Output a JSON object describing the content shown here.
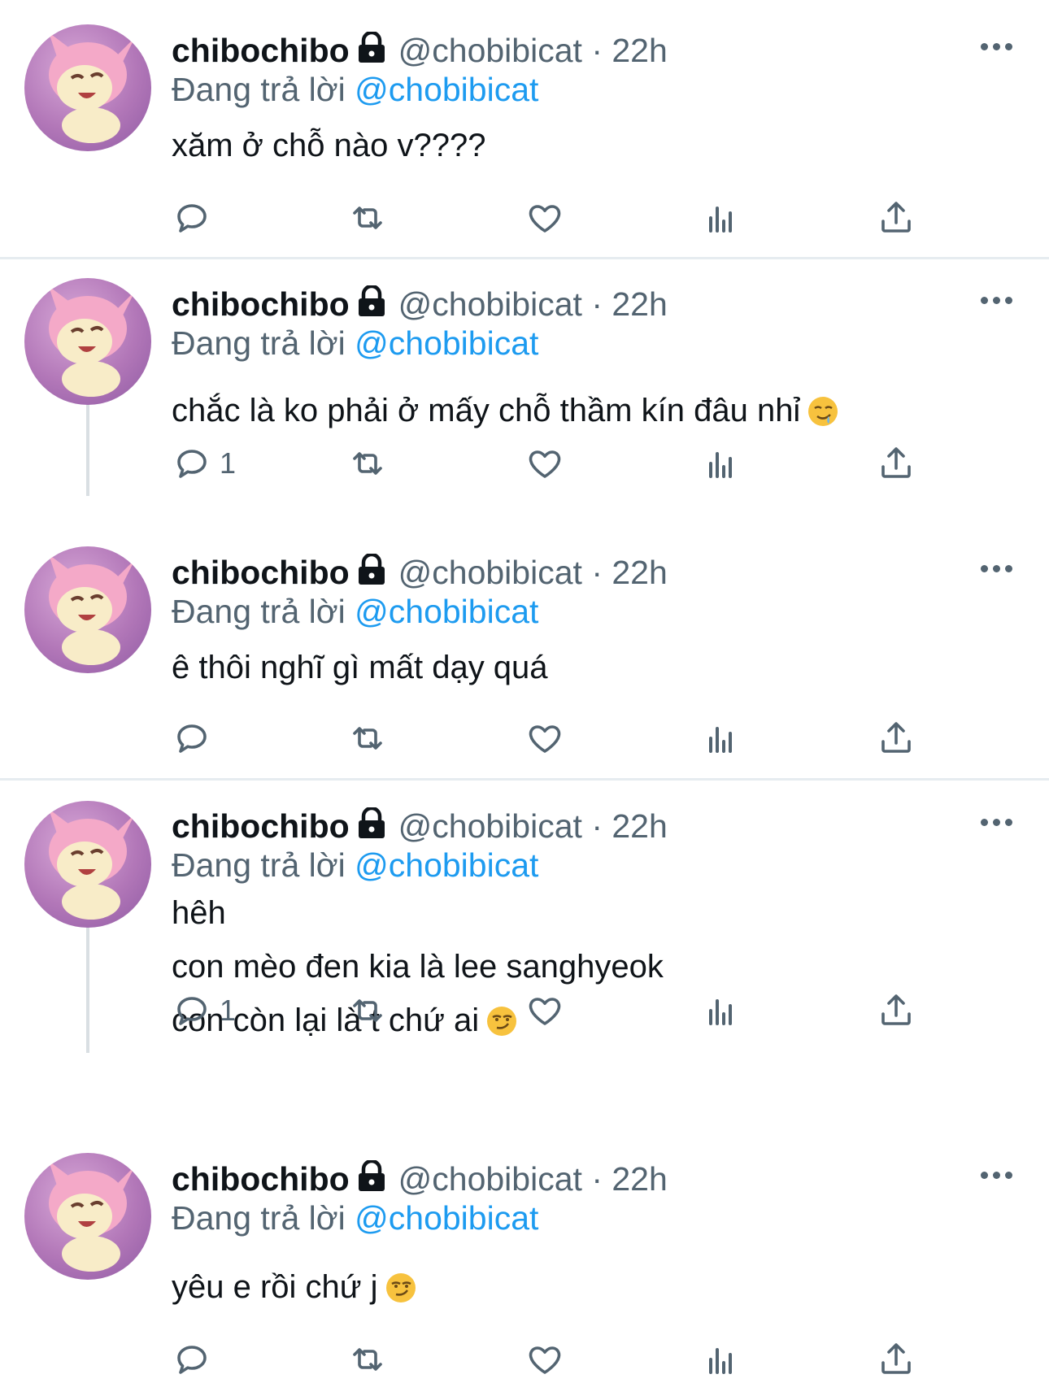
{
  "tweets": [
    {
      "name": "chibochibo",
      "handle": "@chobibicat",
      "dot": "·",
      "time": "22h",
      "replying_label": "Đang trả lời",
      "replying_to": "@chobibicat",
      "lines": [
        "xăm ở chỗ nào v????"
      ],
      "emoji": "",
      "reply_count": ""
    },
    {
      "name": "chibochibo",
      "handle": "@chobibicat",
      "dot": "·",
      "time": "22h",
      "replying_label": "Đang trả lời",
      "replying_to": "@chobibicat",
      "lines": [
        "chắc là ko phải ở mấy chỗ thầm kín đâu nhỉ"
      ],
      "emoji": "drooling-face",
      "reply_count": "1"
    },
    {
      "name": "chibochibo",
      "handle": "@chobibicat",
      "dot": "·",
      "time": "22h",
      "replying_label": "Đang trả lời",
      "replying_to": "@chobibicat",
      "lines": [
        "ê thôi nghĩ gì mất dạy quá"
      ],
      "emoji": "",
      "reply_count": ""
    },
    {
      "name": "chibochibo",
      "handle": "@chobibicat",
      "dot": "·",
      "time": "22h",
      "replying_label": "Đang trả lời",
      "replying_to": "@chobibicat",
      "lines": [
        "hêh",
        "con mèo đen kia là lee sanghyeok",
        "con còn lại là t chứ ai"
      ],
      "emoji": "smirking-face",
      "reply_count": "1"
    },
    {
      "name": "chibochibo",
      "handle": "@chobibicat",
      "dot": "·",
      "time": "22h",
      "replying_label": "Đang trả lời",
      "replying_to": "@chobibicat",
      "lines": [
        "yêu e rồi chứ j"
      ],
      "emoji": "smirking-face",
      "reply_count": ""
    }
  ],
  "icons": {
    "reply": "reply-icon",
    "retweet": "retweet-icon",
    "like": "heart-icon",
    "views": "views-icon",
    "share": "share-icon",
    "protected": "lock-icon",
    "more": "more-icon"
  },
  "colors": {
    "name": "#0f1419",
    "secondary": "#536471",
    "mention": "#1d9bf0",
    "divider": "#e6ecf0",
    "thread_line": "#d9dfe3"
  }
}
